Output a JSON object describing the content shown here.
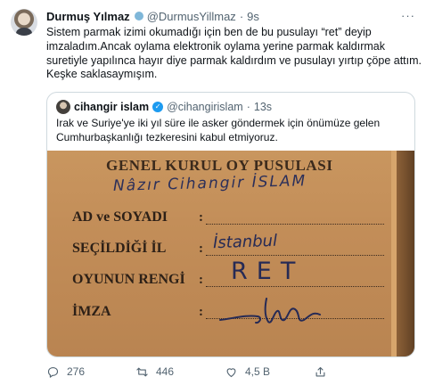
{
  "tweet": {
    "author_name": "Durmuş Yılmaz",
    "author_handle": "@DurmusYillmaz",
    "separator": "·",
    "time": "9s",
    "more_label": "···",
    "lines": [
      "Sistem parmak izimi okumadığı için ben de bu pusulayı “ret” deyip",
      "imzaladım.Ancak oylama elektronik oylama yerine parmak kaldırmak",
      "suretiyle yapılınca hayır diye parmak kaldırdım ve pusulayı yırtıp çöpe attım.",
      "Keşke saklasaymışım."
    ]
  },
  "quote": {
    "author_name": "cihangir islam",
    "verified_icon": "verified-check-icon",
    "author_handle": "@cihangirislam",
    "separator": "·",
    "time": "13s",
    "lines": [
      "Irak ve Suriye'ye iki yıl süre ile asker göndermek için önümüze gelen",
      "Cumhurbaşkanlığı tezkeresini kabul etmiyoruz."
    ],
    "ballot": {
      "title": "GENEL KURUL OY PUSULASI",
      "handwritten_name": "Nâzır Cihangir İSLAM",
      "label_name": "AD ve SOYADI",
      "label_province": "SEÇİLDİĞİ İL",
      "value_province": "İstanbul",
      "label_vote": "OYUNUN RENGİ",
      "value_vote": "RET",
      "label_signature": "İMZA",
      "colon": ":"
    }
  },
  "actions": {
    "reply_icon": "reply-icon",
    "reply_count": "276",
    "retweet_icon": "retweet-icon",
    "retweet_count": "446",
    "like_icon": "heart-icon",
    "like_count": "4,5 B",
    "share_icon": "share-icon"
  }
}
